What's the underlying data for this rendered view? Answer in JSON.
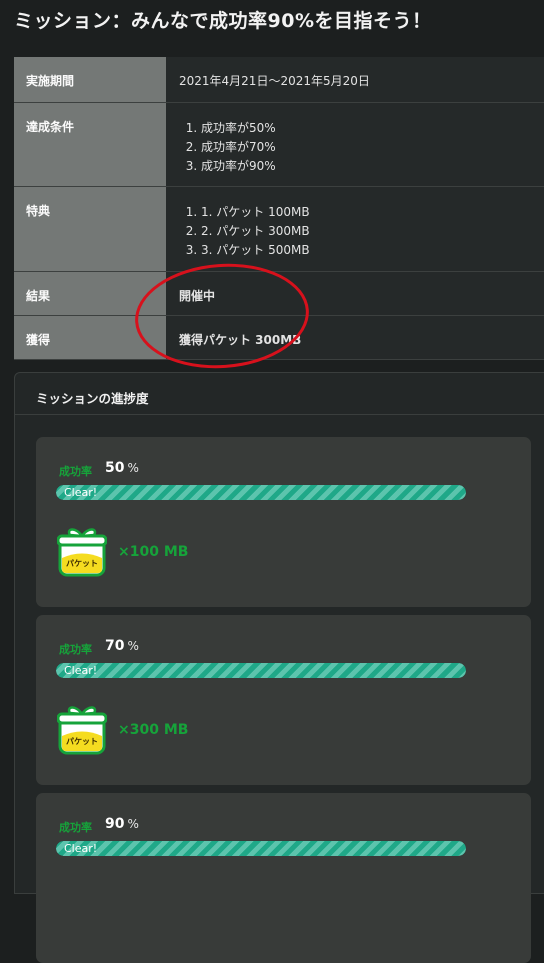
{
  "page": {
    "title": "ミッション：みんなで成功率90%を目指そう！"
  },
  "info": {
    "period": {
      "label": "実施期間",
      "value": "2021年4月21日～2021年5月20日"
    },
    "conditions": {
      "label": "達成条件",
      "items": [
        "成功率が50%",
        "成功率が70%",
        "成功率が90%"
      ]
    },
    "benefits": {
      "label": "特典",
      "items": [
        "1. パケット 100MB",
        "2. パケット 300MB",
        "3. パケット 500MB"
      ]
    },
    "result": {
      "label": "結果",
      "value": "開催中"
    },
    "acquired": {
      "label": "獲得",
      "value": "獲得パケット 300MB"
    }
  },
  "progress": {
    "heading": "ミッションの進捗度",
    "cards": [
      {
        "rate_label": "成功率",
        "rate": "50",
        "unit": "%",
        "status": "Clear!",
        "fill": 1.0,
        "gift_text": "パケット",
        "reward": "×100 MB"
      },
      {
        "rate_label": "成功率",
        "rate": "70",
        "unit": "%",
        "status": "Clear!",
        "fill": 1.0,
        "gift_text": "パケット",
        "reward": "×300 MB"
      },
      {
        "rate_label": "成功率",
        "rate": "90",
        "unit": "%",
        "status": "Clear!",
        "fill": 1.0
      }
    ]
  },
  "colors": {
    "accent_green": "#16a33a",
    "bar_teal": "#1fa888",
    "highlight_red": "#d7111c"
  }
}
